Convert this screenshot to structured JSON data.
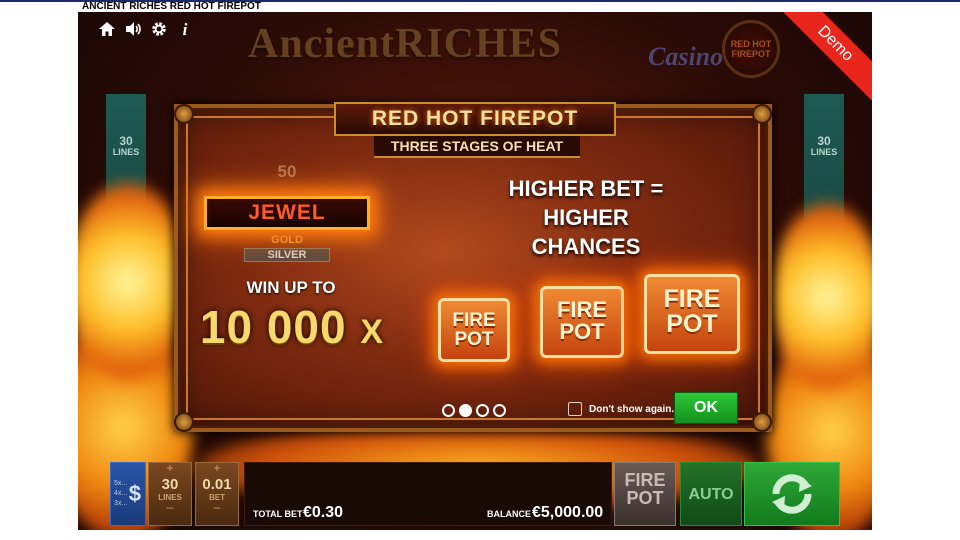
{
  "window": {
    "title": "ANCIENT RICHES RED HOT FIREPOT"
  },
  "hud": {
    "icons": [
      "home-icon",
      "sound-icon",
      "gear-icon",
      "info-icon"
    ],
    "info_glyph": "i"
  },
  "logo": {
    "main": "AncientRICHES",
    "sub": "Casino",
    "badge": "RED HOT FIREPOT"
  },
  "demo_label": "Demo",
  "side_lines": {
    "count": "30",
    "label": "LINES"
  },
  "dialog": {
    "title": "RED HOT FIREPOT",
    "subtitle": "THREE STAGES OF HEAT",
    "tiers": {
      "top_value": "50",
      "jewel": "JEWEL",
      "gold": "GOLD",
      "silver": "SILVER"
    },
    "win_up_to": "WIN UP TO",
    "win_amount": "10 000",
    "win_multiplier": "X",
    "higher_bet_line1": "HIGHER BET =",
    "higher_bet_line2": "HIGHER CHANCES",
    "pot_line1": "FIRE",
    "pot_line2": "POT",
    "pager": {
      "total": 4,
      "active_index": 1
    },
    "dont_show_again": "Don't show again.",
    "ok": "OK"
  },
  "bottom_bar": {
    "coin_values": [
      "5x...",
      "4x...",
      "3x..."
    ],
    "coin_symbol": "$",
    "lines": {
      "value": "30",
      "label": "LINES"
    },
    "bet": {
      "value": "0.01",
      "label": "BET"
    },
    "plus": "+",
    "minus": "–",
    "total_bet_label": "TOTAL BET",
    "total_bet_value": "€0.30",
    "balance_label": "BALANCE",
    "balance_value": "€5,000.00",
    "firepot_line1": "FIRE",
    "firepot_line2": "POT",
    "auto": "AUTO"
  },
  "colors": {
    "accent_green": "#2ec83a",
    "demo_red": "#e8261c",
    "fire_orange": "#f08a34"
  }
}
